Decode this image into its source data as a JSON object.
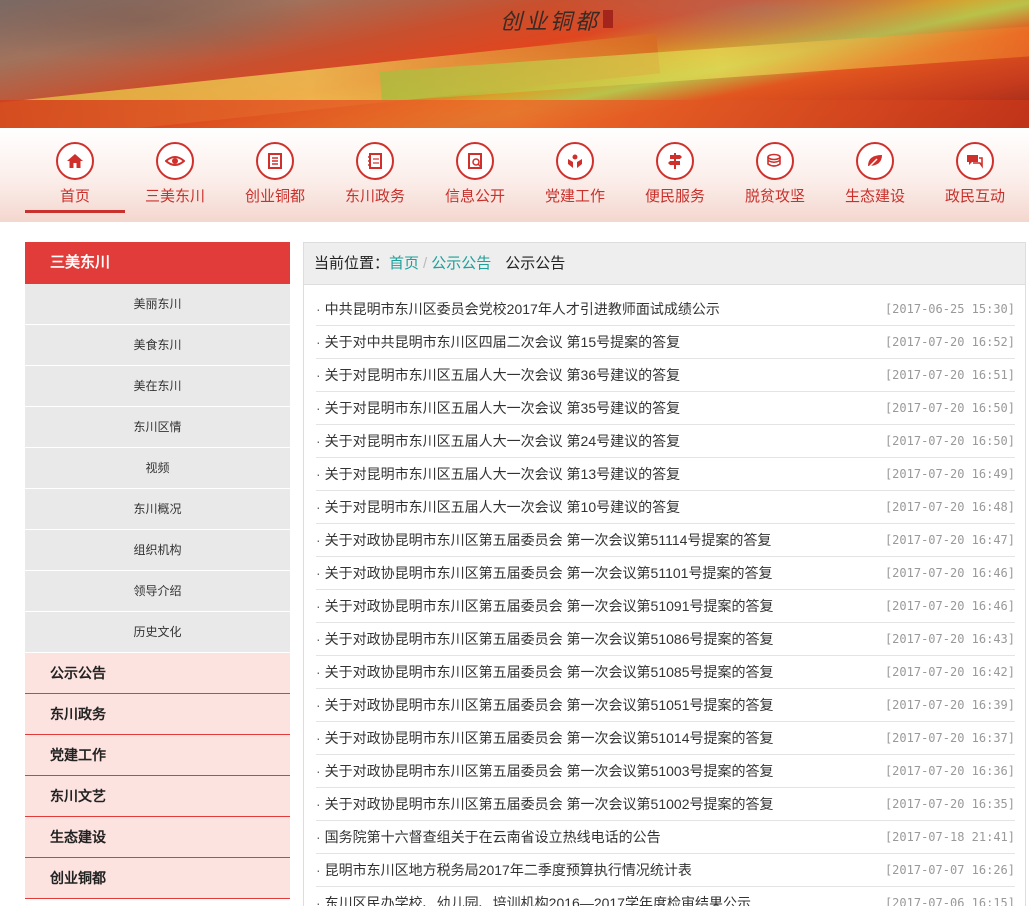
{
  "banner": {
    "logo_text": "创业铜都"
  },
  "nav": [
    {
      "label": "首页",
      "icon": "home-icon"
    },
    {
      "label": "三美东川",
      "icon": "eye-icon"
    },
    {
      "label": "创业铜都",
      "icon": "document-icon"
    },
    {
      "label": "东川政务",
      "icon": "notebook-icon"
    },
    {
      "label": "信息公开",
      "icon": "info-book-icon"
    },
    {
      "label": "党建工作",
      "icon": "hands-icon"
    },
    {
      "label": "便民服务",
      "icon": "signpost-icon"
    },
    {
      "label": "脱贫攻坚",
      "icon": "coins-icon"
    },
    {
      "label": "生态建设",
      "icon": "leaf-icon"
    },
    {
      "label": "政民互动",
      "icon": "chat-icon"
    }
  ],
  "sidebar": {
    "head": "三美东川",
    "subs": [
      "美丽东川",
      "美食东川",
      "美在东川",
      "东川区情",
      "视频",
      "东川概况",
      "组织机构",
      "领导介绍",
      "历史文化"
    ],
    "cats": [
      "公示公告",
      "东川政务",
      "党建工作",
      "东川文艺",
      "生态建设",
      "创业铜都"
    ]
  },
  "breadcrumb": {
    "prefix": "当前位置：",
    "home": "首页",
    "sep": "/",
    "section": "公示公告",
    "current": "公示公告"
  },
  "items": [
    {
      "title": "中共昆明市东川区委员会党校2017年人才引进教师面试成绩公示",
      "date": "[2017-06-25 15:30]"
    },
    {
      "title": "关于对中共昆明市东川区四届二次会议 第15号提案的答复",
      "date": "[2017-07-20 16:52]"
    },
    {
      "title": "关于对昆明市东川区五届人大一次会议 第36号建议的答复",
      "date": "[2017-07-20 16:51]"
    },
    {
      "title": "关于对昆明市东川区五届人大一次会议 第35号建议的答复",
      "date": "[2017-07-20 16:50]"
    },
    {
      "title": "关于对昆明市东川区五届人大一次会议 第24号建议的答复",
      "date": "[2017-07-20 16:50]"
    },
    {
      "title": "关于对昆明市东川区五届人大一次会议 第13号建议的答复",
      "date": "[2017-07-20 16:49]"
    },
    {
      "title": "关于对昆明市东川区五届人大一次会议 第10号建议的答复",
      "date": "[2017-07-20 16:48]"
    },
    {
      "title": "关于对政协昆明市东川区第五届委员会 第一次会议第51114号提案的答复",
      "date": "[2017-07-20 16:47]"
    },
    {
      "title": "关于对政协昆明市东川区第五届委员会 第一次会议第51101号提案的答复",
      "date": "[2017-07-20 16:46]"
    },
    {
      "title": "关于对政协昆明市东川区第五届委员会 第一次会议第51091号提案的答复",
      "date": "[2017-07-20 16:46]"
    },
    {
      "title": "关于对政协昆明市东川区第五届委员会 第一次会议第51086号提案的答复",
      "date": "[2017-07-20 16:43]"
    },
    {
      "title": "关于对政协昆明市东川区第五届委员会 第一次会议第51085号提案的答复",
      "date": "[2017-07-20 16:42]"
    },
    {
      "title": "关于对政协昆明市东川区第五届委员会 第一次会议第51051号提案的答复",
      "date": "[2017-07-20 16:39]"
    },
    {
      "title": "关于对政协昆明市东川区第五届委员会 第一次会议第51014号提案的答复",
      "date": "[2017-07-20 16:37]"
    },
    {
      "title": "关于对政协昆明市东川区第五届委员会 第一次会议第51003号提案的答复",
      "date": "[2017-07-20 16:36]"
    },
    {
      "title": "关于对政协昆明市东川区第五届委员会 第一次会议第51002号提案的答复",
      "date": "[2017-07-20 16:35]"
    },
    {
      "title": "国务院第十六督查组关于在云南省设立热线电话的公告",
      "date": "[2017-07-18 21:41]"
    },
    {
      "title": "昆明市东川区地方税务局2017年二季度预算执行情况统计表",
      "date": "[2017-07-07 16:26]"
    },
    {
      "title": "东川区民办学校、幼儿园、培训机构2016—2017学年度检审结果公示",
      "date": "[2017-07-06 16:15]"
    }
  ],
  "colors": {
    "accent": "#c9312c",
    "sidebar_head": "#e23c3a",
    "link": "#1ea09b"
  }
}
